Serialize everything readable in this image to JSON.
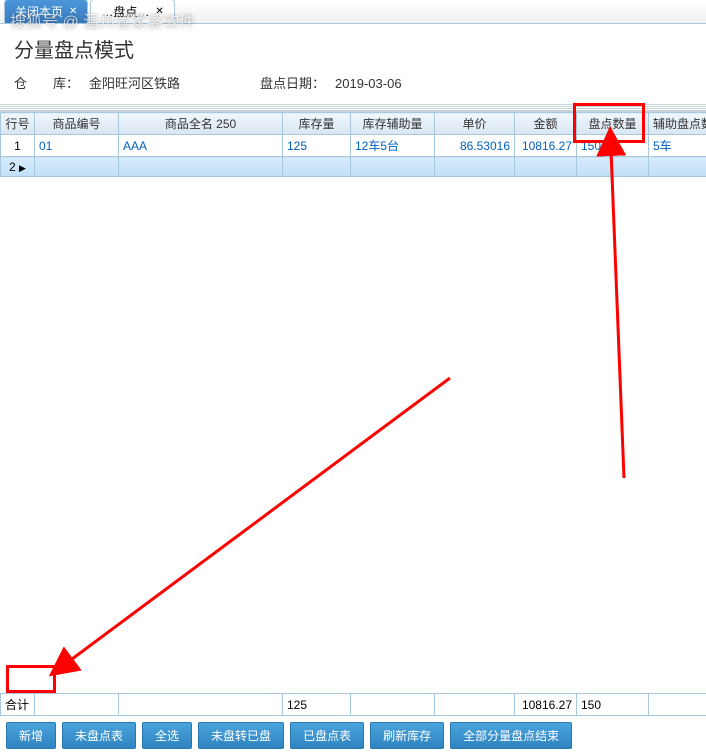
{
  "watermark": "搜狐号 @ 温州管家婆软件",
  "tabs": {
    "active_label": "关闭本页",
    "second_label": "…盘点…"
  },
  "page": {
    "title": "分量盘点模式",
    "warehouse_label": "仓　　库：",
    "warehouse_value": "金阳旺河区铁路",
    "date_label": "盘点日期：",
    "date_value": "2019-03-06"
  },
  "columns": {
    "row_no": "行号",
    "item_code": "商品编号",
    "item_name": "商品全名 250",
    "stock_qty": "库存量",
    "stock_aux": "库存辅助量",
    "unit_price": "单价",
    "amount": "金额",
    "count_qty": "盘点数量",
    "aux_count": "辅助盘点数"
  },
  "rows": [
    {
      "row_no": "1",
      "item_code": "01",
      "item_name": "AAA",
      "stock_qty": "125",
      "stock_aux": "12车5台",
      "unit_price": "86.53016",
      "amount": "10816.27",
      "count_qty": "150",
      "aux_count": "5车"
    },
    {
      "row_no": "2",
      "item_code": "",
      "item_name": "",
      "stock_qty": "",
      "stock_aux": "",
      "unit_price": "",
      "amount": "",
      "count_qty": "",
      "aux_count": ""
    }
  ],
  "totals": {
    "label": "合计",
    "stock_qty": "125",
    "amount": "10816.27",
    "count_qty": "150"
  },
  "buttons": {
    "add": "新增",
    "uncounted": "未盘点表",
    "select_all": "全选",
    "uncounted_to_counted": "未盘转已盘",
    "counted": "已盘点表",
    "refresh_stock": "刷新库存",
    "all_portion_end": "全部分量盘点结束"
  }
}
